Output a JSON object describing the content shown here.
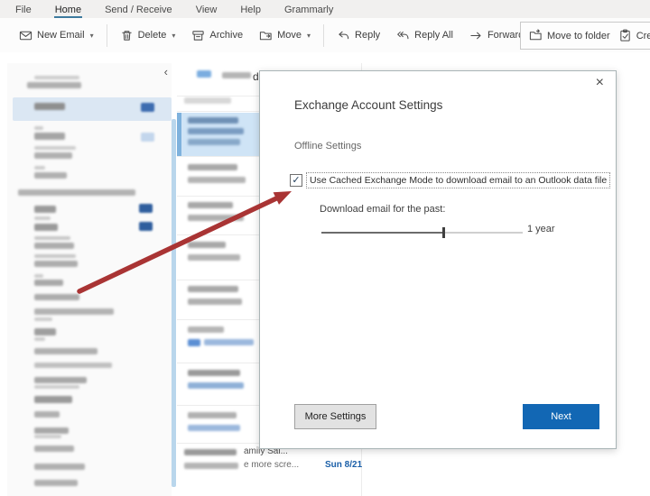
{
  "menu_bar": {
    "tabs": [
      {
        "label": "File"
      },
      {
        "label": "Home"
      },
      {
        "label": "Send / Receive"
      },
      {
        "label": "View"
      },
      {
        "label": "Help"
      },
      {
        "label": "Grammarly"
      }
    ],
    "active_tab": "Home"
  },
  "toolbar": {
    "buttons": [
      {
        "label": "New Email",
        "icon": "envelope-icon",
        "has_dropdown": true
      },
      {
        "label": "Delete",
        "icon": "trash-icon",
        "has_dropdown": true
      },
      {
        "label": "Archive",
        "icon": "archive-box-icon",
        "has_dropdown": false
      },
      {
        "label": "Move",
        "icon": "folder-move-icon",
        "has_dropdown": true
      },
      {
        "label": "Reply",
        "icon": "reply-arrow-icon",
        "has_dropdown": false
      },
      {
        "label": "Reply All",
        "icon": "reply-all-arrow-icon",
        "has_dropdown": false
      },
      {
        "label": "Forward",
        "icon": "forward-arrow-icon",
        "has_dropdown": false
      },
      {
        "label": "Move to folder",
        "icon": "move-to-folder-icon",
        "has_dropdown": false
      },
      {
        "label": "Create a",
        "icon": "clipboard-icon",
        "has_dropdown": false
      }
    ],
    "caret_glyph": "▾"
  },
  "folder_pane": {
    "collapse_glyph": "‹"
  },
  "message_list": {
    "reading_pane_fragment": "d",
    "bottom_item": {
      "subject_fragment": "amily Sal...",
      "preview_fragment": "e more scre...",
      "date": "Sun 8/21"
    }
  },
  "dialog": {
    "title": "Exchange Account Settings",
    "close_glyph": "×",
    "section_heading": "Offline Settings",
    "checkbox": {
      "checked": true,
      "check_glyph": "✓",
      "label": "Use Cached Exchange Mode to download email to an Outlook data file"
    },
    "slider": {
      "label": "Download email for the past:",
      "value_label": "1 year",
      "fill_percent": 60.5
    },
    "buttons": {
      "more_settings": "More Settings",
      "next": "Next"
    }
  },
  "colors": {
    "accent_blue": "#1267b4",
    "arrow_red": "#a93434",
    "selection_blue": "#cfe4f6",
    "badge_blue": "#3d6cb0",
    "tab_underline": "#3d7a9e"
  }
}
